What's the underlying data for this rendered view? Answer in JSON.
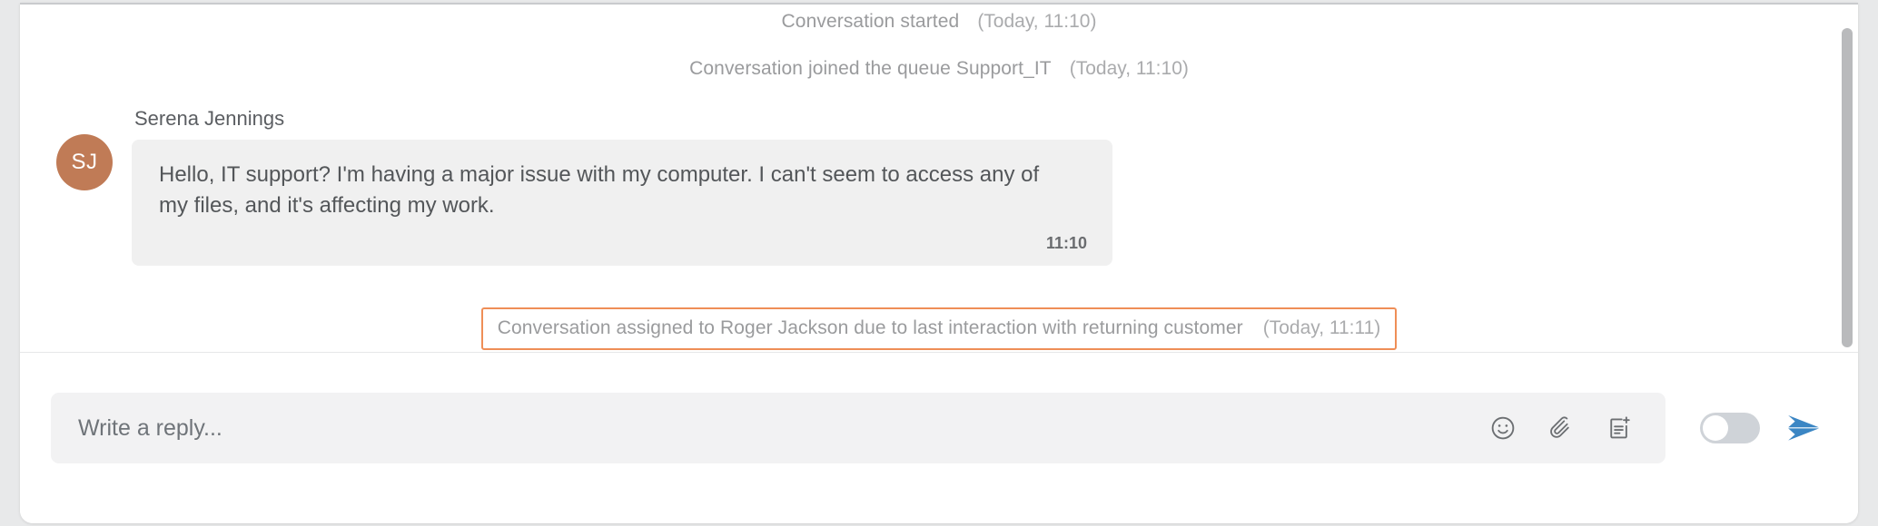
{
  "colors": {
    "page_background": "#e8e9ea",
    "card_background": "#ffffff",
    "bubble_background": "#f0f0f0",
    "avatar_background": "#c07b56",
    "highlight_border": "#ef8e57",
    "send_accent": "#3b86c4",
    "toggle_off_track": "#cfd3d8",
    "system_text": "#9a9b9d",
    "scrollbar_thumb": "#b9babc"
  },
  "thread": {
    "events": [
      {
        "id": "conversation-started",
        "text": "Conversation started",
        "time": "(Today, 11:10)",
        "highlighted": false
      },
      {
        "id": "conversation-queued",
        "text": "Conversation joined the queue Support_IT",
        "time": "(Today, 11:10)",
        "highlighted": false
      },
      {
        "id": "conversation-assigned",
        "text": "Conversation assigned to Roger Jackson due to last interaction with returning customer",
        "time": "(Today, 11:11)",
        "highlighted": true
      }
    ],
    "messages": [
      {
        "id": "inbound-message-1",
        "sender": "Serena Jennings",
        "avatar_initials": "SJ",
        "direction": "inbound",
        "text": "Hello, IT support? I'm having a major issue with my computer. I can't seem to access any of my files, and it's affecting my work.",
        "time": "11:10"
      }
    ]
  },
  "composer": {
    "placeholder": "Write a reply...",
    "value": "",
    "icons": [
      {
        "name": "emoji-icon",
        "label": "Insert emoji"
      },
      {
        "name": "paperclip-icon",
        "label": "Attach file"
      },
      {
        "name": "template-add-icon",
        "label": "Insert canned response"
      }
    ],
    "toggle": {
      "name": "note-mode-toggle",
      "state": "off"
    },
    "send": {
      "name": "send-button",
      "label": "Send"
    }
  },
  "scrollbar": {
    "orientation": "vertical",
    "thumb_position": "top"
  }
}
